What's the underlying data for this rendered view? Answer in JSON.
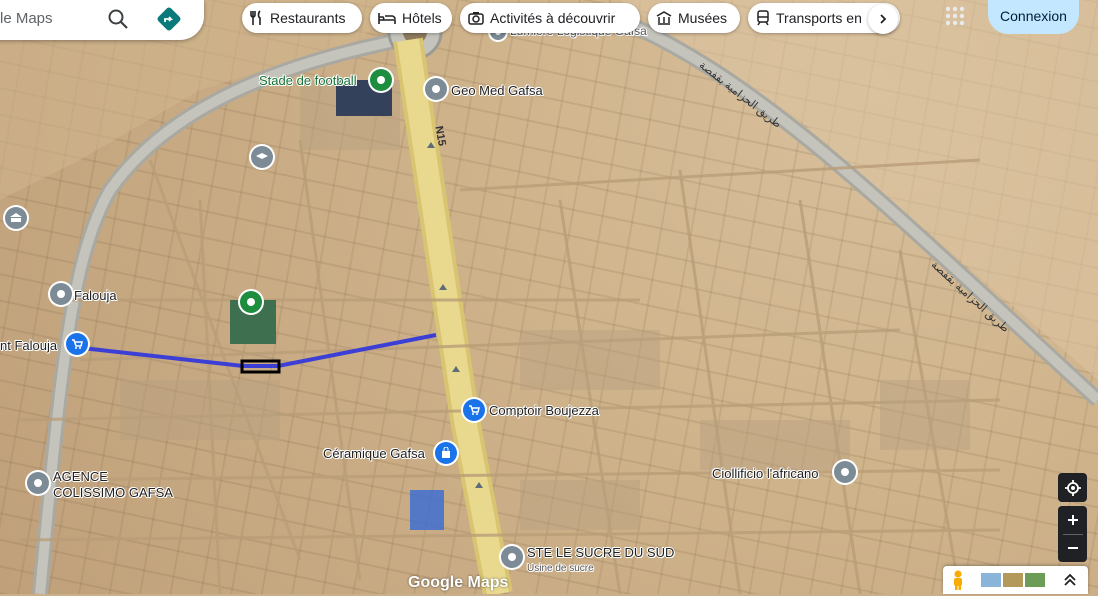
{
  "search": {
    "placeholder_text": "le Maps"
  },
  "chips": [
    {
      "label": "Restaurants",
      "icon": "fork-knife-icon"
    },
    {
      "label": "Hôtels",
      "icon": "bed-icon"
    },
    {
      "label": "Activités à découvrir",
      "icon": "camera-icon"
    },
    {
      "label": "Musées",
      "icon": "museum-icon"
    },
    {
      "label": "Transports en",
      "icon": "transit-icon"
    }
  ],
  "account": {
    "signin_label": "Connexion"
  },
  "places": {
    "stade": "Stade de football",
    "geomed": "Geo Med Gafsa",
    "falouja": "Falouja",
    "market_falouja": "nt Falouja",
    "comptoir": "Comptoir Boujezza",
    "ceramique": "Céramique Gafsa",
    "agence": "AGENCE",
    "colissimo": "COLISSIMO GAFSA",
    "ciolllificio": "Ciollificio l'africano",
    "sucre": "STE LE SUCRE DU SUD",
    "sucre_sub": "Usine de sucre",
    "logistique": "Lumière Logistique Gafsa"
  },
  "roads": {
    "n15": "N15",
    "arabic": "طريق الحزامية بقفصة"
  },
  "logo": "Google Maps",
  "colors": {
    "accent_blue": "#1a73e8",
    "route": "#3b3fd6",
    "pin_green": "#1e8e3e",
    "pin_gray": "#7c8b95",
    "signin_bg": "#c2e7ff"
  }
}
